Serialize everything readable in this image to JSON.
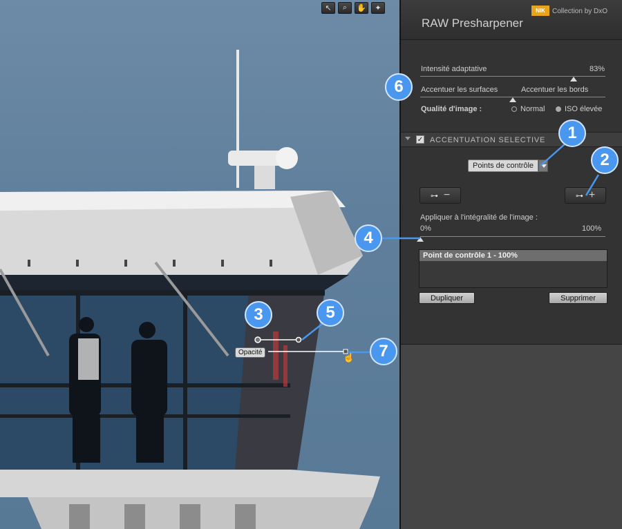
{
  "toolbar": {
    "tools": [
      {
        "icon": "arrow-pointer-icon",
        "glyph": "↖"
      },
      {
        "icon": "zoom-icon",
        "glyph": "⌕"
      },
      {
        "icon": "hand-icon",
        "glyph": "✋"
      },
      {
        "icon": "light-icon",
        "glyph": "✦"
      }
    ]
  },
  "photo": {
    "control_point_label": "Opacité"
  },
  "callouts": [
    "1",
    "2",
    "3",
    "4",
    "5",
    "6",
    "7"
  ],
  "panel": {
    "logo_text": "NIK",
    "collection_text": "Collection by DxO",
    "title": "RAW Presharpener",
    "adaptive_label": "Intensité adaptative",
    "adaptive_value": "83%",
    "adaptive_level": 0.83,
    "surfaces_label": "Accentuer les surfaces",
    "edges_label": "Accentuer les bords",
    "surfaces_edges_level": 0.5,
    "quality_label": "Qualité d'image :",
    "quality_options": [
      "Normal",
      "ISO élevée"
    ],
    "quality_selected": "ISO élevée",
    "selective": {
      "title": "ACCENTUATION SELECTIVE",
      "checked": true,
      "mode": "Points de contrôle",
      "apply_label": "Appliquer à l'intégralité de l'image :",
      "apply_min": "0%",
      "apply_max": "100%",
      "apply_level": 0,
      "list_items": [
        "Point de contrôle 1 - 100%"
      ],
      "duplicate_label": "Dupliquer",
      "delete_label": "Supprimer"
    }
  },
  "colors": {
    "badge": "#4a97ef",
    "nik": "#e8a51c"
  }
}
